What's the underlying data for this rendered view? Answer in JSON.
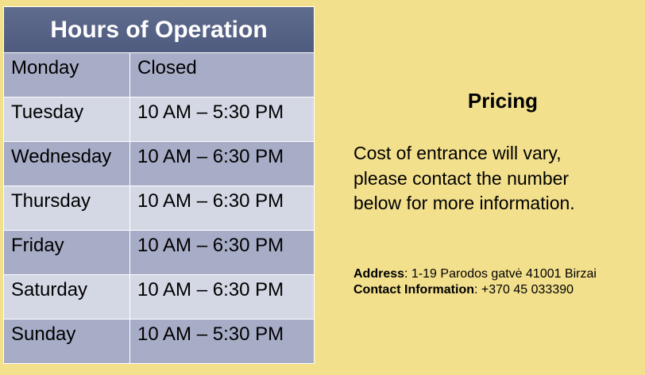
{
  "hours": {
    "title": "Hours of Operation",
    "rows": [
      {
        "day": "Monday",
        "time": "Closed"
      },
      {
        "day": "Tuesday",
        "time": "10 AM – 5:30 PM"
      },
      {
        "day": "Wednesday",
        "time": "10 AM – 6:30 PM"
      },
      {
        "day": "Thursday",
        "time": "10 AM – 6:30 PM"
      },
      {
        "day": "Friday",
        "time": "10 AM – 6:30 PM"
      },
      {
        "day": "Saturday",
        "time": "10 AM – 6:30 PM"
      },
      {
        "day": "Sunday",
        "time": "10 AM – 5:30 PM"
      }
    ]
  },
  "pricing": {
    "title": "Pricing",
    "line1": "Cost of entrance will vary,",
    "line2": "please contact the number",
    "line3": "below for more information."
  },
  "contact": {
    "address_label": "Address",
    "address_value": ": 1-19 Parodos gatvė 41001 Birzai",
    "contact_label": "Contact Information",
    "contact_value": ": +370 45 033390"
  },
  "colors": {
    "background": "#f3e08d",
    "header": "#5f6c8e",
    "row_dark": "#a7adc7",
    "row_light": "#d3d8e4"
  }
}
